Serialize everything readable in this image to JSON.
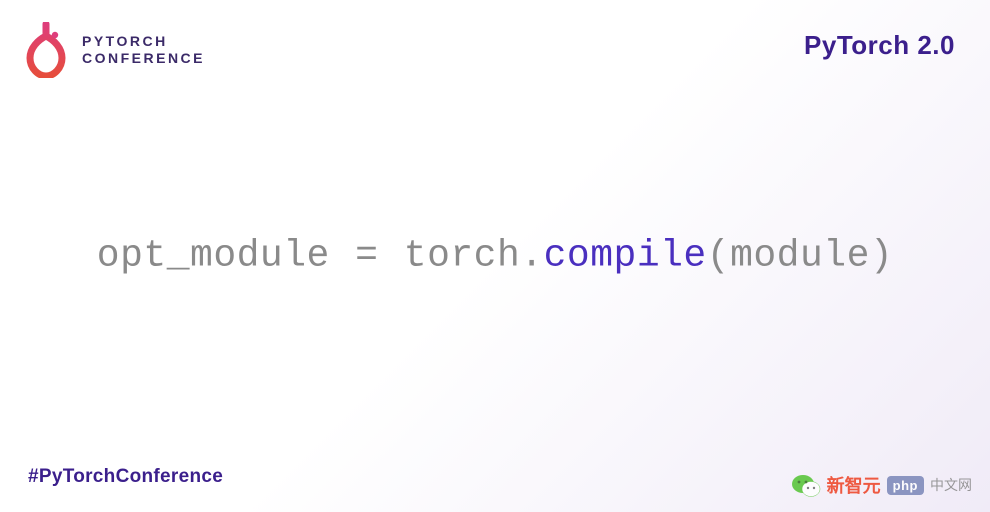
{
  "header": {
    "logo_line1": "PYTORCH",
    "logo_line2": "CONFERENCE",
    "title": "PyTorch 2.0"
  },
  "code": {
    "variable": "opt_module",
    "equals": " = ",
    "object": "torch",
    "dot": ".",
    "method": "compile",
    "open": "(",
    "arg": "module",
    "close": ")"
  },
  "footer": {
    "hashtag": "#PyTorchConference"
  },
  "watermark": {
    "cn1": "新智元",
    "php": "php",
    "cn2": "中文网"
  }
}
